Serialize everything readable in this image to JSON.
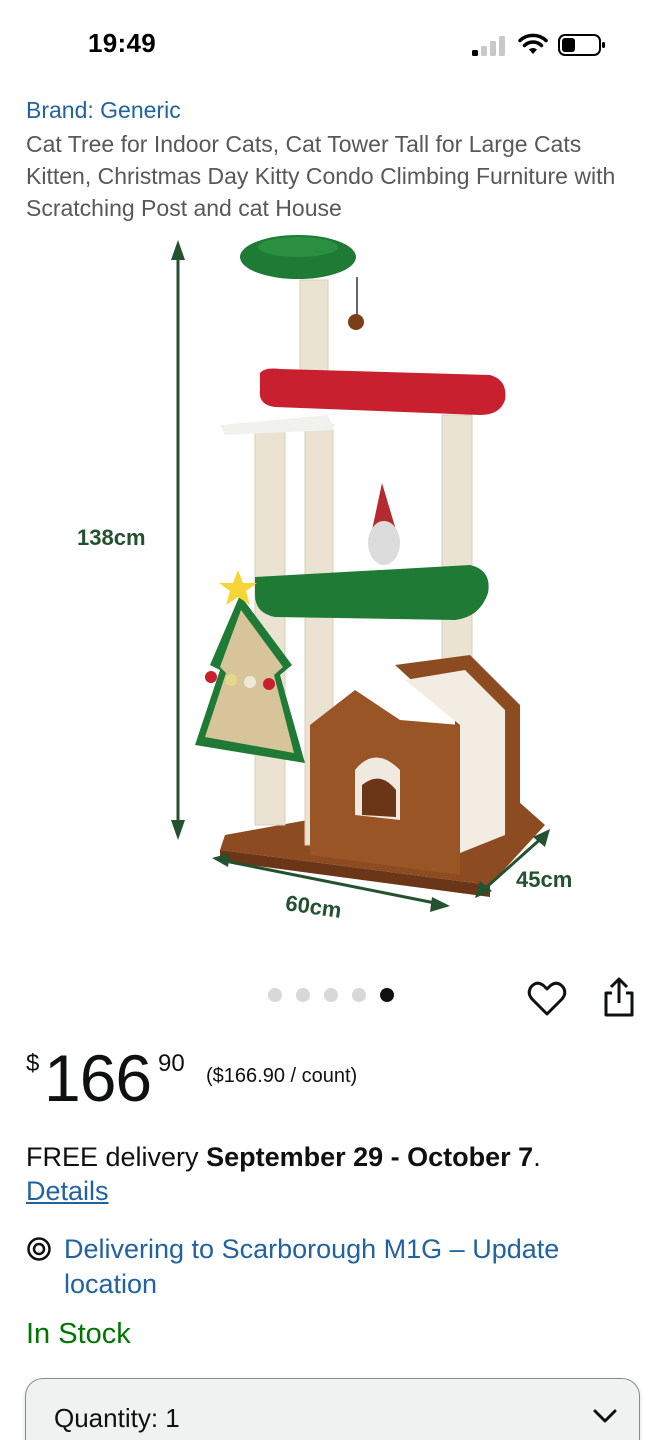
{
  "status_bar": {
    "time": "19:49"
  },
  "product": {
    "brand": "Brand: Generic",
    "title": "Cat Tree for Indoor Cats, Cat Tower Tall for Large Cats Kitten, Christmas Day Kitty Condo Climbing Furniture with Scratching Post and cat House",
    "image": {
      "height_label": "138cm",
      "width_label": "60cm",
      "depth_label": "45cm"
    }
  },
  "carousel": {
    "total": 5,
    "active_index": 4
  },
  "price": {
    "symbol": "$",
    "whole": "166",
    "fraction": "90",
    "per_unit": "($166.90 / count)"
  },
  "delivery": {
    "prefix": "FREE delivery ",
    "dates": "September 29 - October 7",
    "suffix": ".",
    "details_link": "Details",
    "location": "Delivering to Scarborough M1G – Update location"
  },
  "stock": {
    "text": "In Stock",
    "color": "#007600"
  },
  "quantity": {
    "label": "Quantity: 1"
  },
  "colors": {
    "link": "#2162a1",
    "text": "#0f1111",
    "muted": "#565959",
    "in_stock": "#007600"
  },
  "icons": [
    "signal-icon",
    "wifi-icon",
    "battery-icon",
    "heart-icon",
    "share-icon",
    "location-pin-icon",
    "chevron-down-icon"
  ]
}
